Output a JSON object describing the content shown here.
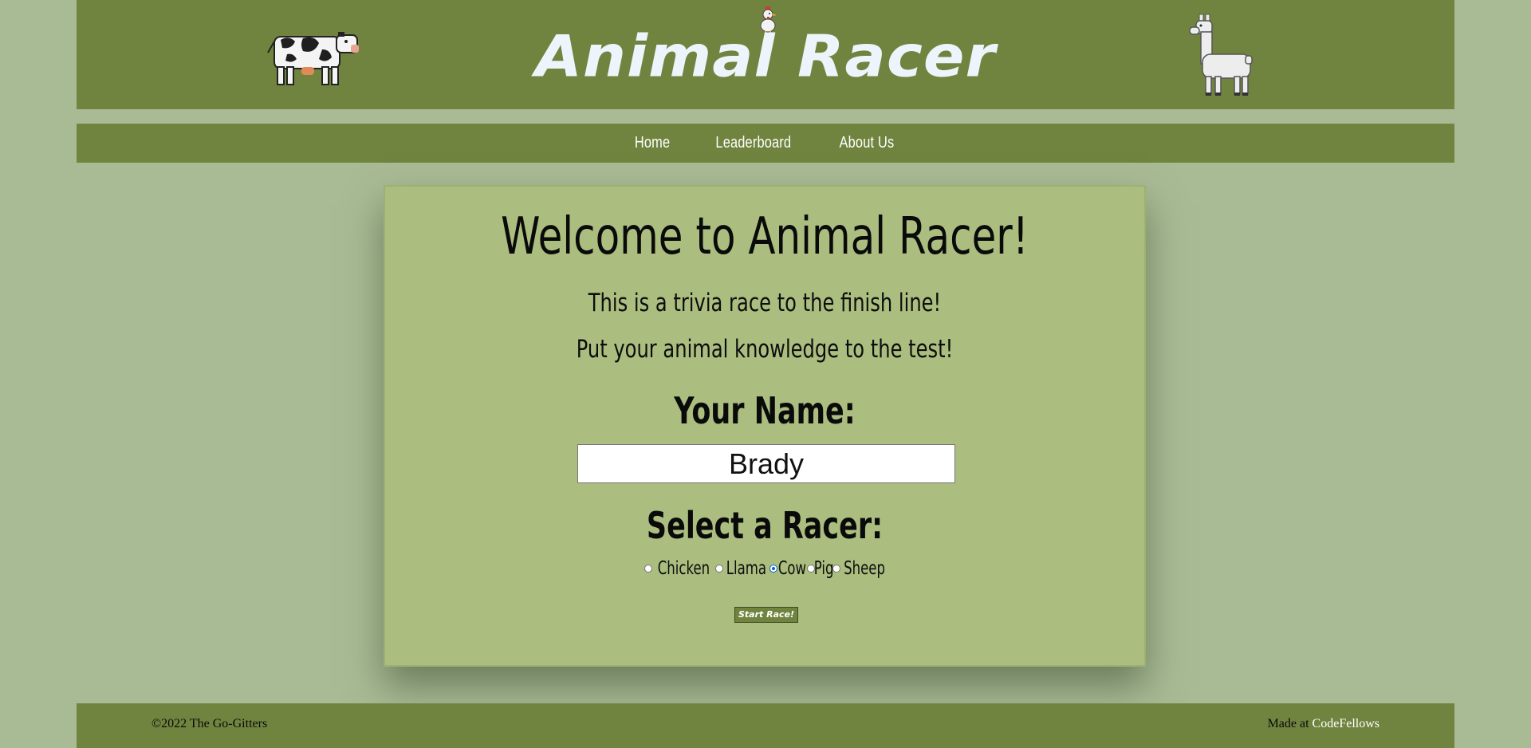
{
  "header": {
    "title": "Animal Racer",
    "left_sprite": "cow-icon",
    "right_sprite": "llama-icon",
    "title_sprite": "chicken-icon"
  },
  "nav": {
    "items": [
      {
        "label": "Home"
      },
      {
        "label": "Leaderboard"
      },
      {
        "label": "About Us"
      }
    ]
  },
  "main": {
    "heading": "Welcome to Animal Racer!",
    "line1": "This is a trivia race to the finish line!",
    "line2": "Put your animal knowledge to the test!",
    "name_label": "Your Name:",
    "name_value": "Brady",
    "racer_label": "Select a Racer:",
    "racers": [
      {
        "label": "Chicken",
        "checked": false
      },
      {
        "label": "Llama",
        "checked": false
      },
      {
        "label": "Cow",
        "checked": true
      },
      {
        "label": "Pig",
        "checked": false
      },
      {
        "label": "Sheep",
        "checked": false
      }
    ],
    "start_button": "Start Race!"
  },
  "footer": {
    "copyright": "©2022 The Go-Gitters",
    "made_at_prefix": "Made at ",
    "made_at_link": "CodeFellows"
  },
  "colors": {
    "page_bg": "#a9bb95",
    "bar_bg": "#71843f",
    "card_bg": "#abbe7f",
    "title_text": "#eef4fb",
    "radio_accent": "#0b63ce"
  }
}
